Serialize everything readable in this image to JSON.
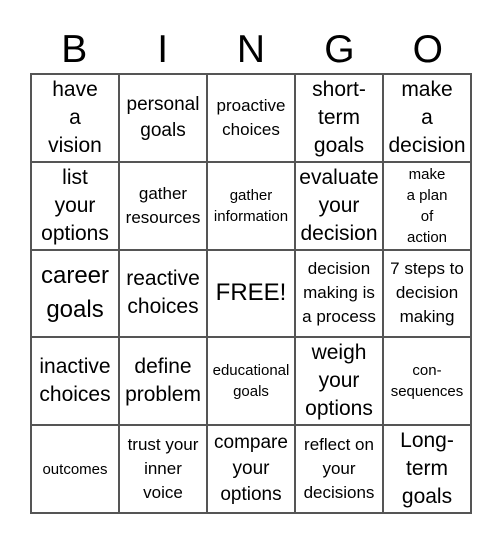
{
  "title_letters": [
    "B",
    "I",
    "N",
    "G",
    "O"
  ],
  "cells": [
    {
      "text": "have\na\nvision",
      "size": "xl"
    },
    {
      "text": "personal\ngoals",
      "size": "lg"
    },
    {
      "text": "proactive\nchoices",
      "size": "md"
    },
    {
      "text": "short-\nterm\ngoals",
      "size": "xl"
    },
    {
      "text": "make\na\ndecision",
      "size": "xl"
    },
    {
      "text": "list\nyour\noptions",
      "size": "xl"
    },
    {
      "text": "gather\nresources",
      "size": "md"
    },
    {
      "text": "gather\ninformation",
      "size": "sm"
    },
    {
      "text": "evaluate\nyour\ndecision",
      "size": "xl"
    },
    {
      "text": "make\na plan\nof\naction",
      "size": "sm"
    },
    {
      "text": "career\ngoals",
      "size": "xxl"
    },
    {
      "text": "reactive\nchoices",
      "size": "xl"
    },
    {
      "text": "FREE!",
      "size": "xxl"
    },
    {
      "text": "decision\nmaking is\na process",
      "size": "md"
    },
    {
      "text": "7 steps to\ndecision\nmaking",
      "size": "md"
    },
    {
      "text": "inactive\nchoices",
      "size": "xl"
    },
    {
      "text": "define\nproblem",
      "size": "xl"
    },
    {
      "text": "educational\ngoals",
      "size": "sm"
    },
    {
      "text": "weigh\nyour\noptions",
      "size": "xl"
    },
    {
      "text": "con-\nsequences",
      "size": "sm"
    },
    {
      "text": "outcomes",
      "size": "sm"
    },
    {
      "text": "trust your\ninner\nvoice",
      "size": "md"
    },
    {
      "text": "compare\nyour\noptions",
      "size": "lg"
    },
    {
      "text": "reflect on\nyour\ndecisions",
      "size": "md"
    },
    {
      "text": "Long-\nterm\ngoals",
      "size": "xl"
    }
  ]
}
